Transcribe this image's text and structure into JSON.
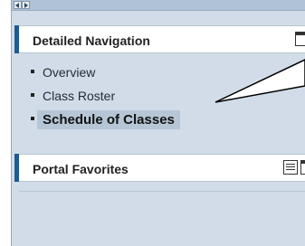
{
  "detailed_navigation": {
    "title": "Detailed Navigation",
    "items": [
      {
        "label": "Overview",
        "active": false
      },
      {
        "label": "Class Roster",
        "active": false
      },
      {
        "label": "Schedule of Classes",
        "active": true
      }
    ]
  },
  "portal_favorites": {
    "title": "Portal Favorites"
  },
  "icons": {
    "scroll_left": "left-arrow-icon",
    "scroll_right": "right-arrow-icon",
    "menu": "menu-icon",
    "window": "window-icon"
  },
  "colors": {
    "panel_background": "#d1dce8",
    "header_accent": "#1f5a94",
    "active_highlight": "#b7c6d6"
  }
}
